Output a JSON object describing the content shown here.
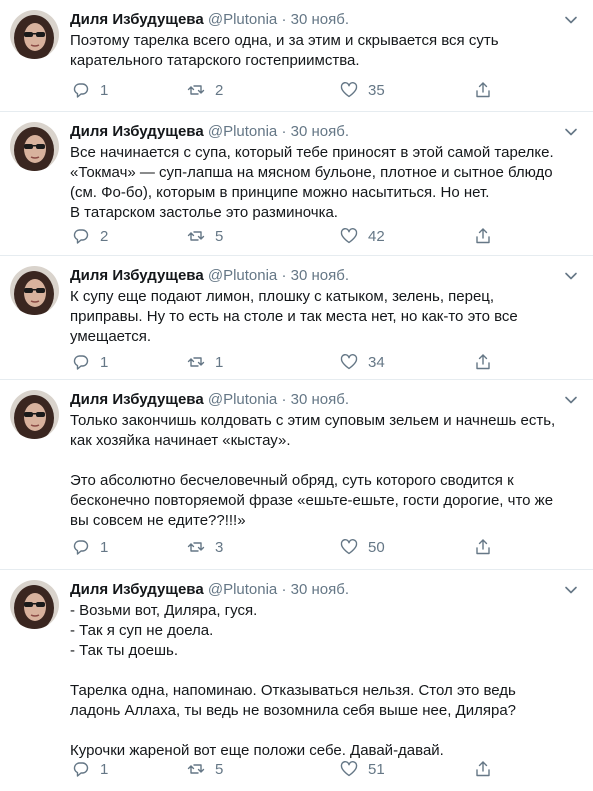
{
  "tweets": [
    {
      "name": "Диля Избудущева",
      "handle": "@Plutonia",
      "sep": "·",
      "date": "30 нояб.",
      "text": "Поэтому тарелка всего одна, и за этим и скрывается вся суть карательного татарского гостеприимства.",
      "replies": "1",
      "retweets": "2",
      "likes": "35"
    },
    {
      "name": "Диля Избудущева",
      "handle": "@Plutonia",
      "sep": "·",
      "date": "30 нояб.",
      "text": "Все начинается с супа, который тебе приносят в этой самой тарелке.\n«Токмач» — суп-лапша на мясном бульоне, плотное и сытное блюдо\n(см. Фо-бо), которым в принципе можно насытиться. Но нет.\nВ татарском застолье это разминочка.",
      "replies": "2",
      "retweets": "5",
      "likes": "42"
    },
    {
      "name": "Диля Избудущева",
      "handle": "@Plutonia",
      "sep": "·",
      "date": "30 нояб.",
      "text": "К супу еще подают лимон, плошку с катыком, зелень, перец,\nприправы. Ну то есть на столе и так места нет, но как-то это все\nумещается.",
      "replies": "1",
      "retweets": "1",
      "likes": "34"
    },
    {
      "name": "Диля Избудущева",
      "handle": "@Plutonia",
      "sep": "·",
      "date": "30 нояб.",
      "text": "Только закончишь колдовать с этим суповым зельем и начнешь есть,\nкак хозяйка начинает «кыстау».\n\nЭто абсолютно бесчеловечный обряд, суть которого сводится к\nбесконечно повторяемой фразе «ешьте-ешьте, гости дорогие, что же\nвы совсем не едите??!!!»",
      "replies": "1",
      "retweets": "3",
      "likes": "50"
    },
    {
      "name": "Диля Избудущева",
      "handle": "@Plutonia",
      "sep": "·",
      "date": "30 нояб.",
      "text": "- Возьми вот, Диляра, гуся.\n- Так я суп не доела.\n- Так ты доешь.\n\nТарелка одна, напоминаю. Отказываться нельзя. Стол это ведь\nладонь Аллаха, ты ведь не возомнила себя выше нее, Диляра?\n\nКурочки жареной вот еще положи себе. Давай-давай.",
      "replies": "1",
      "retweets": "5",
      "likes": "51"
    }
  ],
  "icons": {
    "reply": "reply-icon",
    "retweet": "retweet-icon",
    "like": "heart-icon",
    "share": "share-icon",
    "menu": "chevron-down-icon"
  },
  "colors": {
    "text": "#14171a",
    "muted": "#657786",
    "border": "#e6ecf0"
  }
}
